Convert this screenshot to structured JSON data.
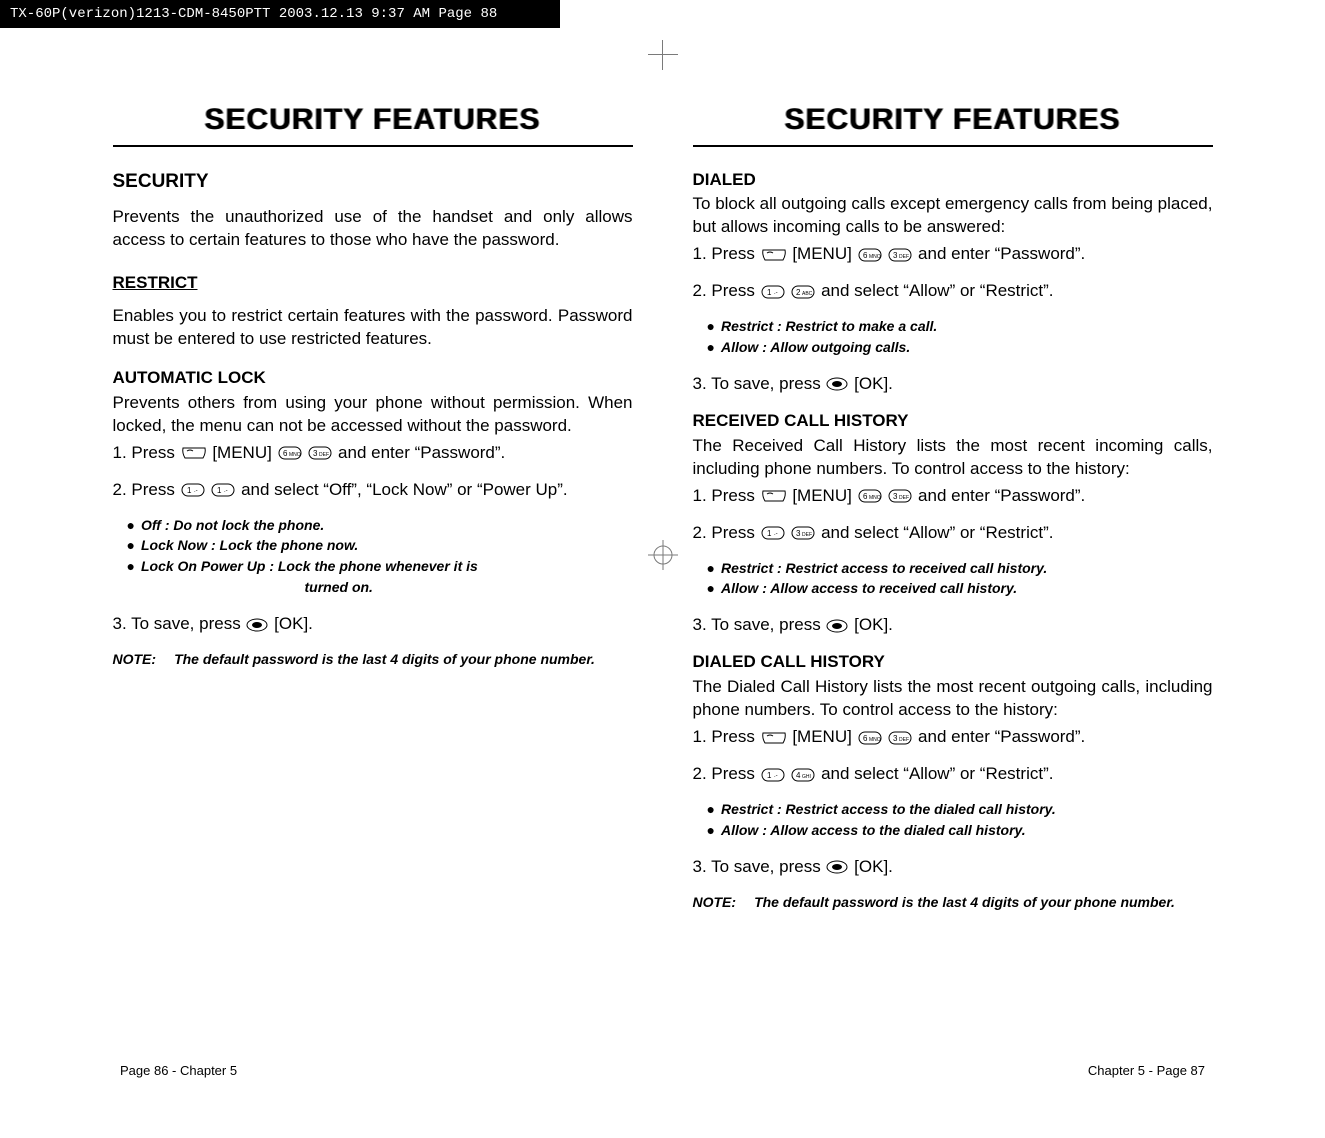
{
  "header_bar": "TX-60P(verizon)1213-CDM-8450PTT  2003.12.13  9:37 AM  Page 88",
  "left": {
    "title": "SECURITY FEATURES",
    "h2": "SECURITY",
    "intro": "Prevents the unauthorized use of the handset and only allows access to certain features to those who have the password.",
    "restrict_h": "RESTRICT",
    "restrict_p": "Enables you to restrict certain features with the password. Password must be entered to use restricted features.",
    "auto_h": "AUTOMATIC LOCK",
    "auto_p": "Prevents others from using your phone without permission. When locked, the menu can not be accessed without the password.",
    "auto_s1a": "1. Press ",
    "auto_s1b": " [MENU] ",
    "auto_s1c": " and enter “Password”.",
    "auto_s2a": "2. Press",
    "auto_s2b": "and select “Off”, “Lock Now” or “Power Up”.",
    "auto_b1": "Off : Do not lock the phone.",
    "auto_b2": "Lock Now : Lock the phone now.",
    "auto_b3": "Lock On Power Up : Lock the phone whenever it is",
    "auto_b3_cont": "turned on.",
    "auto_s3a": "3. To save, press ",
    "auto_s3b": " [OK].",
    "note_label": "NOTE:",
    "note_body": "The default password is the last 4 digits of your phone number."
  },
  "right": {
    "title": "SECURITY FEATURES",
    "dialed_h": "DIALED",
    "dialed_p": "To block all outgoing calls except emergency calls from being placed, but allows incoming calls to be answered:",
    "dialed_s1a": "1. Press ",
    "dialed_s1b": " [MENU] ",
    "dialed_s1c": " and enter “Password”.",
    "dialed_s2a": "2. Press ",
    "dialed_s2b": " and select “Allow” or “Restrict”.",
    "dialed_b1": "Restrict : Restrict to make a call.",
    "dialed_b2": "Allow : Allow outgoing calls.",
    "save_a": "3. To save, press ",
    "save_b": " [OK].",
    "rcv_h": "RECEIVED CALL HISTORY",
    "rcv_p": "The Received Call History lists the most recent incoming calls, including phone numbers. To control access to the history:",
    "rcv_s1a": "1. Press ",
    "rcv_s1b": " [MENU] ",
    "rcv_s1c": " and enter “Password”.",
    "rcv_s2a": "2. Press ",
    "rcv_s2b": " and select “Allow” or “Restrict”.",
    "rcv_b1": "Restrict : Restrict access to received call history.",
    "rcv_b2": "Allow : Allow access to received call history.",
    "dch_h": "DIALED CALL HISTORY",
    "dch_p": "The Dialed Call History lists the most recent outgoing calls, including phone numbers. To control access to the history:",
    "dch_s1a": "1. Press ",
    "dch_s1b": " [MENU]",
    "dch_s1c": " and enter “Password”.",
    "dch_s2a": "2. Press ",
    "dch_s2b": " and select “Allow” or “Restrict”.",
    "dch_b1": "Restrict : Restrict access to the dialed call history.",
    "dch_b2": "Allow : Allow access to the dialed call history.",
    "note_label": "NOTE:",
    "note_body": "The default password is the last 4 digits of your phone number."
  },
  "footer_left": "Page 86 - Chapter 5",
  "footer_right": "Chapter 5 - Page 87"
}
